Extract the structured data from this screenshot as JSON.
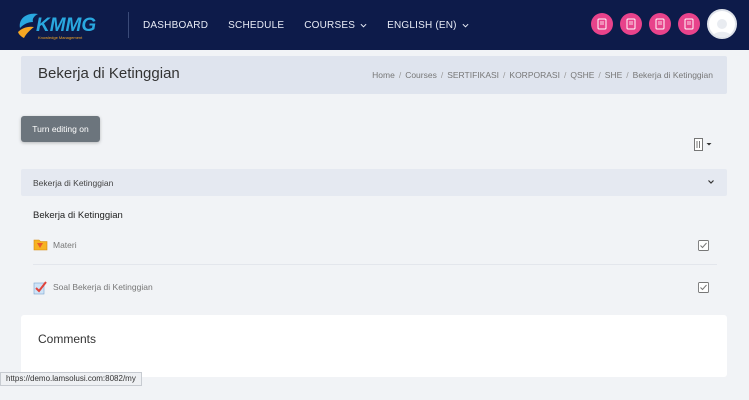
{
  "navbar": {
    "logo_text": "KMMG",
    "logo_subtext": "Knowledge Management",
    "links": [
      {
        "label": "DASHBOARD",
        "has_dropdown": false
      },
      {
        "label": "SCHEDULE",
        "has_dropdown": false
      },
      {
        "label": "COURSES",
        "has_dropdown": true
      },
      {
        "label": "ENGLISH (EN)",
        "has_dropdown": true
      }
    ],
    "action_icons": [
      "document-icon",
      "document-icon",
      "document-icon",
      "document-icon"
    ],
    "accent_color": "#e8438b",
    "bg_color": "#0d1b4a"
  },
  "header": {
    "title": "Bekerja di Ketinggian",
    "breadcrumb": [
      "Home",
      "Courses",
      "SERTIFIKASI",
      "KORPORASI",
      "QSHE",
      "SHE",
      "Bekerja di Ketinggian"
    ],
    "separator": "/"
  },
  "toolbar": {
    "edit_label": "Turn editing on"
  },
  "section": {
    "title": "Bekerja di Ketinggian",
    "name": "Bekerja di Ketinggian"
  },
  "activities": [
    {
      "label": "Materi",
      "icon": "folder-icon"
    },
    {
      "label": "Soal Bekerja di Ketinggian",
      "icon": "quiz-icon"
    }
  ],
  "comments": {
    "title": "Comments"
  },
  "status_bar": {
    "url": "https://demo.lamsolusi.com:8082/my"
  }
}
